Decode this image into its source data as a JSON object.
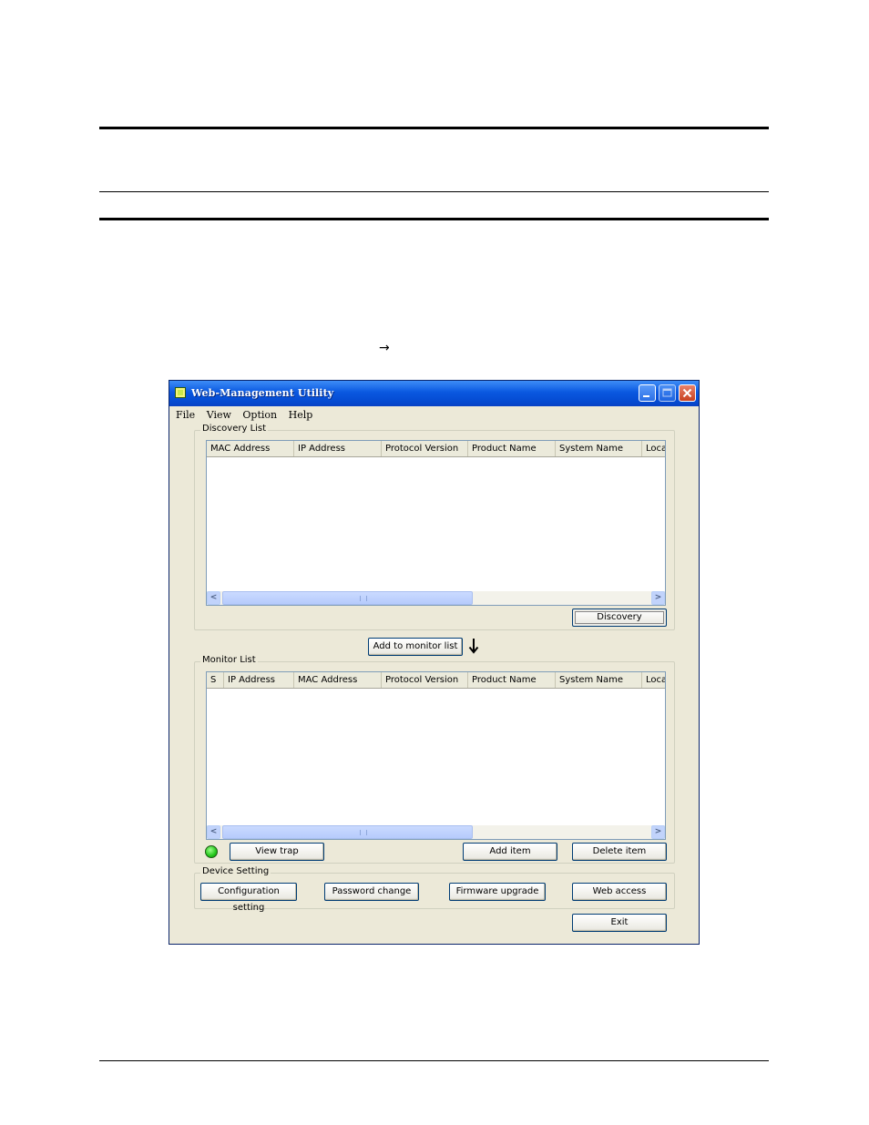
{
  "page": {
    "arrow_symbol": "→"
  },
  "window": {
    "title": "Web-Management Utility",
    "menu": [
      "File",
      "View",
      "Option",
      "Help"
    ]
  },
  "discovery": {
    "group_label": "Discovery List",
    "columns": [
      "MAC Address",
      "IP Address",
      "Protocol Version",
      "Product Name",
      "System Name",
      "Loca"
    ],
    "rows": [],
    "discovery_button": "Discovery"
  },
  "add_to_monitor_button": "Add to monitor list",
  "monitor": {
    "group_label": "Monitor List",
    "columns": [
      "S",
      "IP Address",
      "MAC Address",
      "Protocol Version",
      "Product Name",
      "System Name",
      "Loca"
    ],
    "rows": [],
    "view_trap_button": "View trap",
    "add_item_button": "Add item",
    "delete_item_button": "Delete item",
    "status_led_color": "#22c61a"
  },
  "device_setting": {
    "group_label": "Device Setting",
    "configuration_button": "Configuration setting",
    "password_button": "Password change",
    "firmware_button": "Firmware upgrade",
    "web_access_button": "Web access"
  },
  "exit_button": "Exit"
}
